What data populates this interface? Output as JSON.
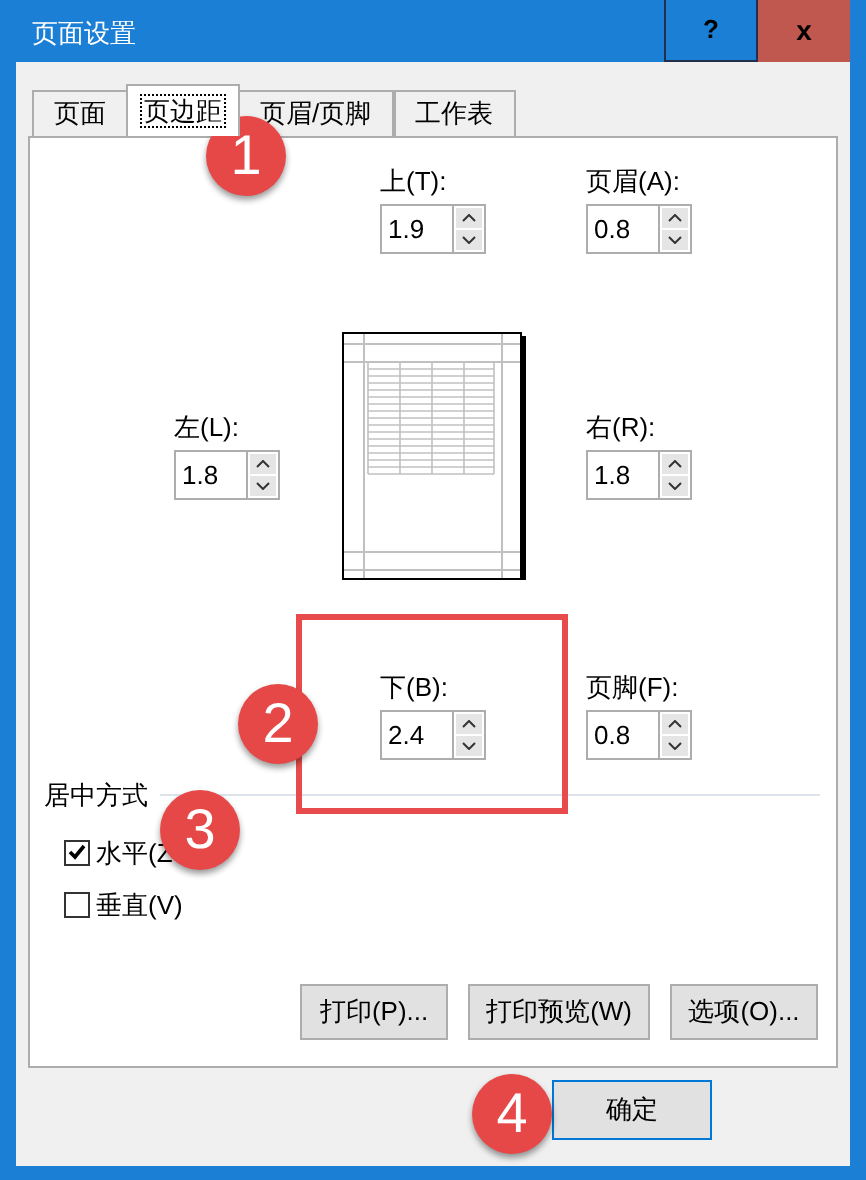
{
  "window": {
    "title": "页面设置",
    "help_button": "?",
    "close_button": "x"
  },
  "tabs": [
    {
      "label": "页面",
      "selected": false
    },
    {
      "label": "页边距",
      "selected": true
    },
    {
      "label": "页眉/页脚",
      "selected": false
    },
    {
      "label": "工作表",
      "selected": false
    }
  ],
  "margins": {
    "top": {
      "label": "上(T):",
      "value": "1.9"
    },
    "header": {
      "label": "页眉(A):",
      "value": "0.8"
    },
    "left": {
      "label": "左(L):",
      "value": "1.8"
    },
    "right": {
      "label": "右(R):",
      "value": "1.8"
    },
    "bottom": {
      "label": "下(B):",
      "value": "2.4"
    },
    "footer": {
      "label": "页脚(F):",
      "value": "0.8"
    }
  },
  "centering": {
    "title": "居中方式",
    "options": [
      {
        "label": "水平(Z",
        "checked": true
      },
      {
        "label": "垂直(V)",
        "checked": false
      }
    ]
  },
  "buttons": [
    "打印(P)...",
    "打印预览(W)",
    "选项(O)..."
  ],
  "ok_button": "确定",
  "annotations": [
    {
      "label": "1"
    },
    {
      "label": "2"
    },
    {
      "label": "3"
    },
    {
      "label": "4"
    }
  ]
}
